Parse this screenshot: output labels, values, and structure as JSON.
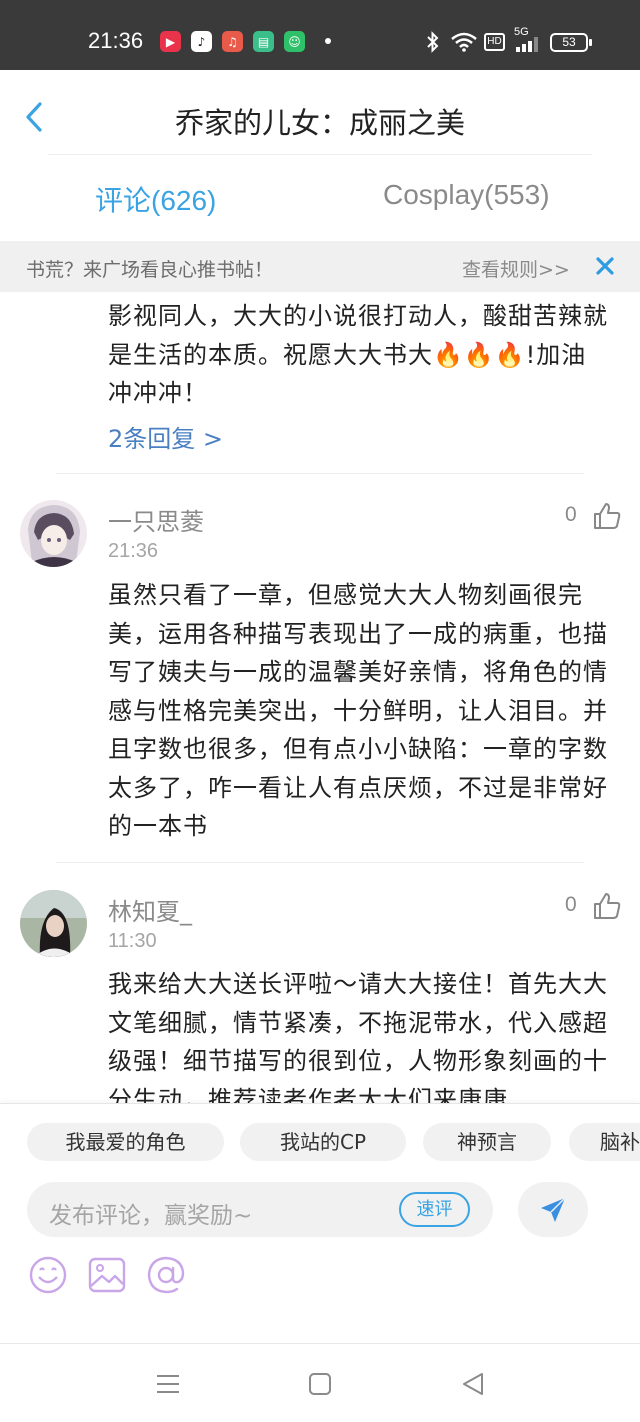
{
  "status_bar": {
    "time": "21:36",
    "network": "5G",
    "hd": "HD",
    "battery": "53"
  },
  "header": {
    "title": "乔家的儿女：成丽之美"
  },
  "tabs": [
    {
      "label": "评论(626)",
      "active": true
    },
    {
      "label": "Cosplay(553)",
      "active": false
    }
  ],
  "banner": {
    "text": "书荒？来广场看良心推书帖！",
    "rules": "查看规则>>"
  },
  "comments": [
    {
      "text": "影视同人，大大的小说很打动人，酸甜苦辣就是生活的本质。祝愿大大书大🔥🔥🔥!加油冲冲冲！",
      "replies": "2条回复 >"
    },
    {
      "username": "一只思菱",
      "time": "21:36",
      "likes": "0",
      "text": "虽然只看了一章，但感觉大大人物刻画很完美，运用各种描写表现出了一成的病重，也描写了姨夫与一成的温馨美好亲情，将角色的情感与性格完美突出，十分鲜明，让人泪目。并且字数也很多，但有点小小缺陷：一章的字数太多了，咋一看让人有点厌烦，不过是非常好的一本书"
    },
    {
      "username": "林知夏_",
      "time": "11:30",
      "likes": "0",
      "text": "我来给大大送长评啦～请大大接住！首先大大文笔细腻，情节紧凑，不拖泥带水，代入感超级强！细节描写的很到位，人物形象刻画的十分生动，推荐读者作者大大们来康康"
    }
  ],
  "compose": {
    "chips": [
      "我最爱的角色",
      "我站的CP",
      "神预言",
      "脑补"
    ],
    "placeholder": "发布评论，赢奖励~",
    "quick_label": "速评"
  },
  "colors": {
    "accent": "#3aa3e3",
    "link": "#4a7fc1",
    "tool_icon": "#c9a6e8"
  }
}
